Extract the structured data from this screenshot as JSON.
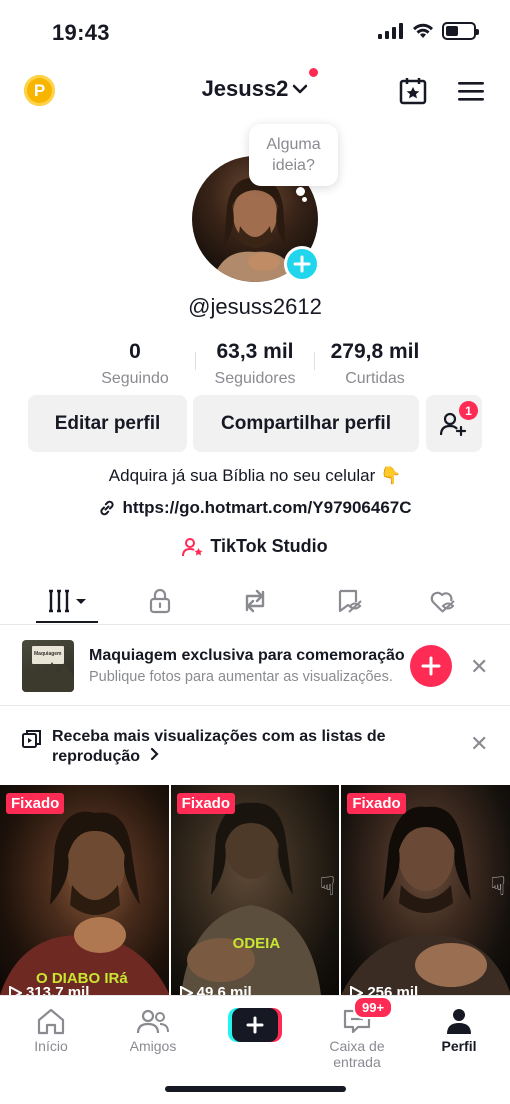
{
  "status": {
    "time": "19:43"
  },
  "header": {
    "username": "Jesuss2",
    "coin_label": "P"
  },
  "bubble": {
    "text_line1": "Alguma",
    "text_line2": "ideia?"
  },
  "profile": {
    "handle": "@jesuss2612",
    "stats": [
      {
        "value": "0",
        "label": "Seguindo"
      },
      {
        "value": "63,3 mil",
        "label": "Seguidores"
      },
      {
        "value": "279,8 mil",
        "label": "Curtidas"
      }
    ],
    "edit_label": "Editar perfil",
    "share_label": "Compartilhar perfil",
    "friend_requests_badge": "1",
    "bio": "Adquira já sua Bíblia no seu celular 👇",
    "link": "https://go.hotmart.com/Y97906467C",
    "studio_label": "TikTok Studio"
  },
  "promo": {
    "title": "Maquiagem exclusiva para comemoração",
    "subtitle": "Publique fotos para aumentar as visualizações.",
    "thumb_text": "Maquiagem"
  },
  "playlist": {
    "title": "Receba mais visualizações com as listas de reprodução"
  },
  "videos": [
    {
      "pinned_label": "Fixado",
      "views": "313,7 mil",
      "overlay": "O DIABO IRá"
    },
    {
      "pinned_label": "Fixado",
      "views": "49,6 mil",
      "overlay": "ODEIA"
    },
    {
      "pinned_label": "Fixado",
      "views": "256 mil",
      "overlay": ""
    }
  ],
  "nav": {
    "home": "Início",
    "friends": "Amigos",
    "inbox": "Caixa de entrada",
    "inbox_badge": "99+",
    "profile": "Perfil"
  },
  "colors": {
    "accent": "#fe2c55",
    "cyan": "#20d5ec",
    "text": "#161823",
    "muted": "#8a8b91"
  }
}
